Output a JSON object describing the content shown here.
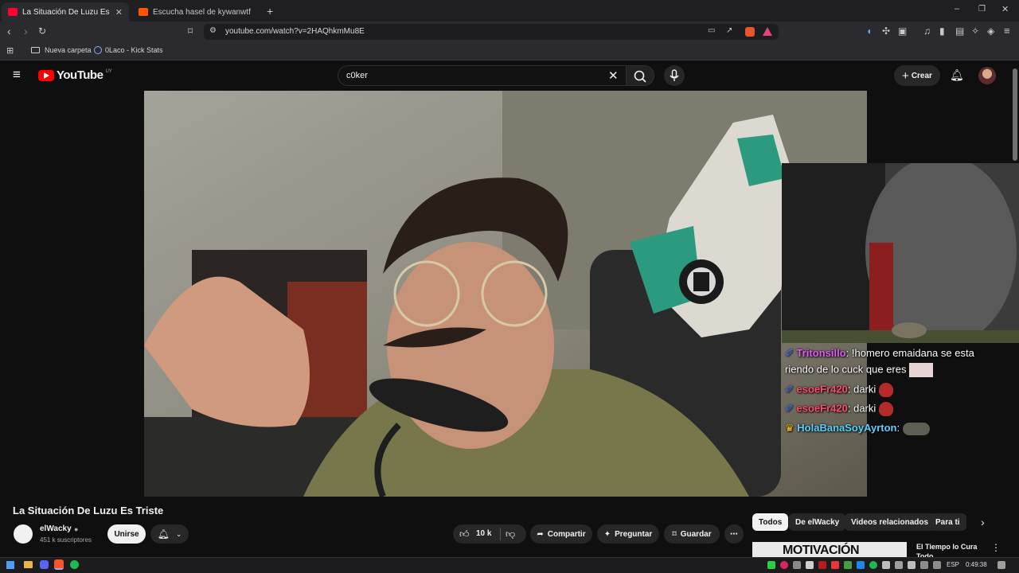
{
  "browser": {
    "tabs": [
      {
        "title": "La Situación De Luzu Es Triste - YouTube",
        "active": true,
        "favicon_color": "#ff0033"
      },
      {
        "title": "Escucha hasel de kywanwtf | Disfruta",
        "active": false,
        "favicon_color": "#ff5500"
      }
    ],
    "new_tab_label": "+",
    "window_controls": {
      "minimize": "–",
      "restore": "❐",
      "close": "✕"
    },
    "url": "youtube.com/watch?v=2HAQhkmMu8E",
    "bookmarks": [
      {
        "label": "Nueva carpeta",
        "icon": "folder-icon"
      },
      {
        "label": "0Laco - Kick Stats",
        "icon": "link-icon"
      }
    ]
  },
  "youtube": {
    "logo_text": "YouTube",
    "country": "UY",
    "search_value": "c0ker",
    "create_label": "Crear",
    "video": {
      "title": "La Situación De Luzu Es Triste",
      "chat": [
        {
          "user": "Tritonsillo",
          "text": "!homero emaidana se esta",
          "user_color": "#e259f5"
        },
        {
          "user": "",
          "text": "riendo de lo cuck que eres",
          "user_color": "#ffffff"
        },
        {
          "user": "esoeFr420",
          "text": "darki",
          "user_color": "#ff4d6d"
        },
        {
          "user": "esoeFr420",
          "text": "darki",
          "user_color": "#ff4d6d"
        },
        {
          "user": "HolaBanaSoyAyrton",
          "text": "",
          "user_color": "#5ad1ff"
        }
      ]
    },
    "channel": {
      "name": "elWacky",
      "subscribers": "451 k suscriptores",
      "join_label": "Unirse"
    },
    "actions": {
      "likes": "10 k",
      "share_label": "Compartir",
      "ask_label": "Preguntar",
      "save_label": "Guardar",
      "more_label": "⋯"
    },
    "chips": [
      "Todos",
      "De elWacky",
      "Videos relacionados",
      "Para ti"
    ],
    "recommended": {
      "thumb_text": "MOTIVACIÓN",
      "title": "El Tiempo lo Cura Todo"
    }
  },
  "taskbar": {
    "lang": "ESP",
    "time": "0:49:38"
  }
}
